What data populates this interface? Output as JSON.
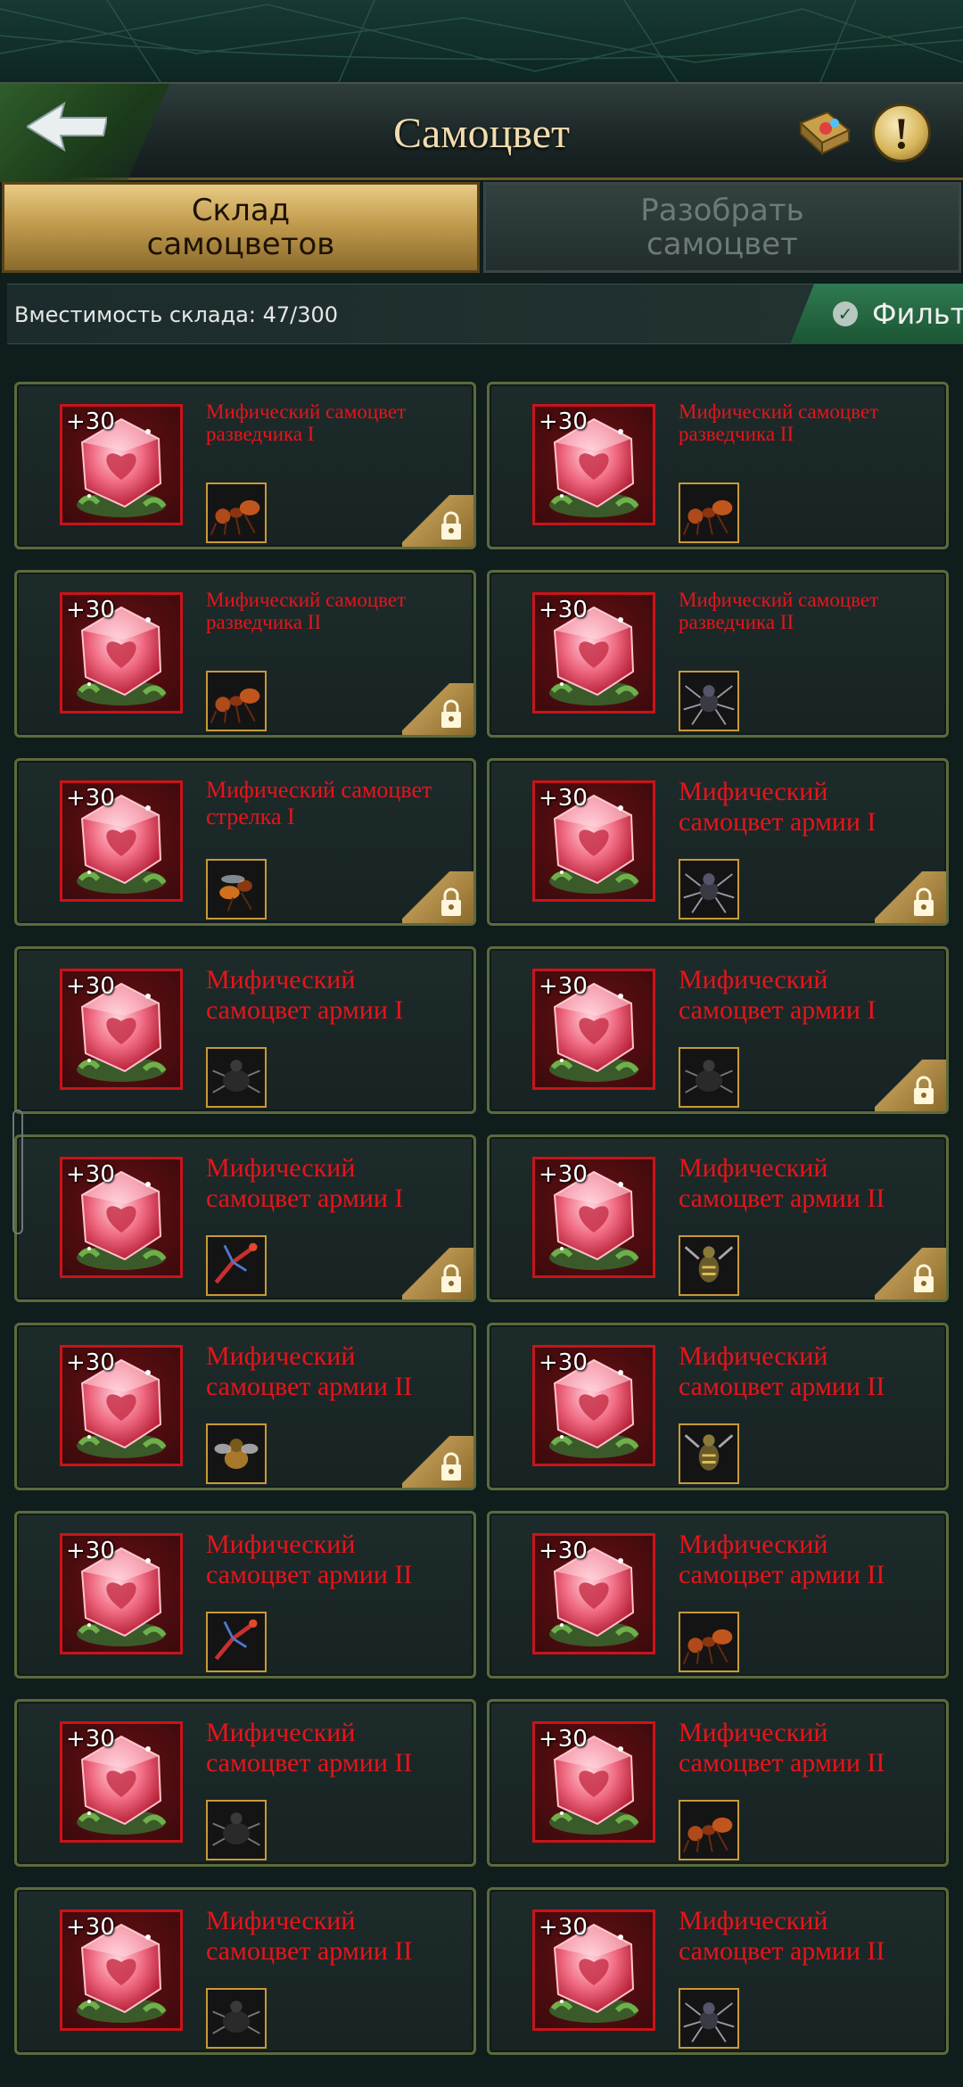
{
  "header": {
    "title": "Самоцвет"
  },
  "tabs": [
    {
      "label": "Склад самоцветов",
      "active": true
    },
    {
      "label": "Разобрать самоцвет",
      "active": false
    }
  ],
  "capacity": {
    "text": "Вместимость склада: 47/300"
  },
  "filter": {
    "label": "Фильт"
  },
  "gems": [
    {
      "level": "+30",
      "name": "Мифический самоцвет разведчика I",
      "size": "small",
      "locked": true,
      "troop_icon": "ant-icon"
    },
    {
      "level": "+30",
      "name": "Мифический самоцвет разведчика II",
      "size": "small",
      "locked": false,
      "troop_icon": "ant-icon"
    },
    {
      "level": "+30",
      "name": "Мифический самоцвет разведчика II",
      "size": "small",
      "locked": true,
      "troop_icon": "ant-icon"
    },
    {
      "level": "+30",
      "name": "Мифический самоцвет разведчика II",
      "size": "small",
      "locked": false,
      "troop_icon": "spider-icon"
    },
    {
      "level": "+30",
      "name": "Мифический самоцвет стрелка I",
      "size": "medium",
      "locked": true,
      "troop_icon": "wasp-icon"
    },
    {
      "level": "+30",
      "name": "Мифический самоцвет армии I",
      "size": "large",
      "locked": true,
      "troop_icon": "spider-icon"
    },
    {
      "level": "+30",
      "name": "Мифический самоцвет армии I",
      "size": "large",
      "locked": false,
      "troop_icon": "beetle-icon"
    },
    {
      "level": "+30",
      "name": "Мифический самоцвет армии I",
      "size": "large",
      "locked": true,
      "troop_icon": "beetle-icon"
    },
    {
      "level": "+30",
      "name": "Мифический самоцвет армии I",
      "size": "large",
      "locked": true,
      "troop_icon": "mantis-icon"
    },
    {
      "level": "+30",
      "name": "Мифический самоцвет армии II",
      "size": "large",
      "locked": true,
      "troop_icon": "hornet-icon"
    },
    {
      "level": "+30",
      "name": "Мифический самоцвет армии II",
      "size": "large",
      "locked": true,
      "troop_icon": "fly-icon"
    },
    {
      "level": "+30",
      "name": "Мифический самоцвет армии II",
      "size": "large",
      "locked": false,
      "troop_icon": "hornet-icon"
    },
    {
      "level": "+30",
      "name": "Мифический самоцвет армии II",
      "size": "large",
      "locked": false,
      "troop_icon": "mantis-icon"
    },
    {
      "level": "+30",
      "name": "Мифический самоцвет армии II",
      "size": "large",
      "locked": false,
      "troop_icon": "ant-icon"
    },
    {
      "level": "+30",
      "name": "Мифический самоцвет армии II",
      "size": "large",
      "locked": false,
      "troop_icon": "beetle-icon"
    },
    {
      "level": "+30",
      "name": "Мифический самоцвет армии II",
      "size": "large",
      "locked": false,
      "troop_icon": "ant-icon"
    },
    {
      "level": "+30",
      "name": "Мифический самоцвет армии II",
      "size": "large",
      "locked": false,
      "troop_icon": "beetle-icon"
    },
    {
      "level": "+30",
      "name": "Мифический самоцвет армии II",
      "size": "large",
      "locked": false,
      "troop_icon": "spider-icon"
    }
  ],
  "colors": {
    "gem_name": "#e8141a",
    "gem_frame": "#c8141a",
    "tab_active": "#c29c4e",
    "filter": "#2f7a50"
  }
}
